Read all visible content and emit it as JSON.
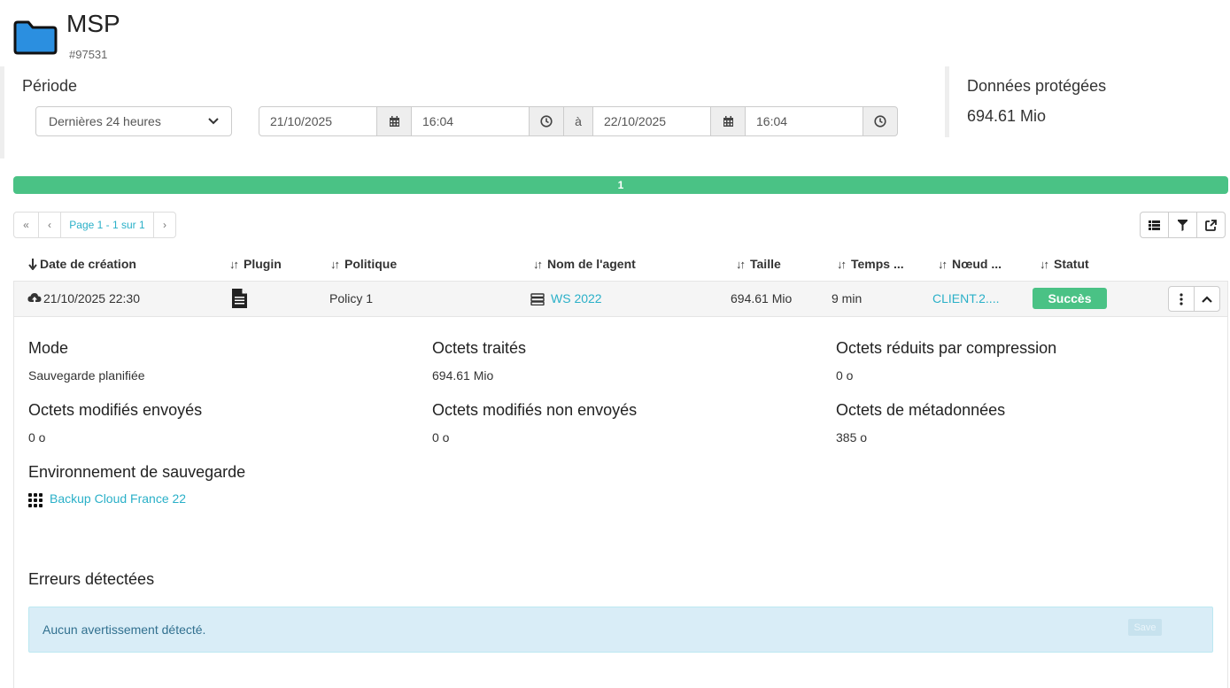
{
  "header": {
    "title": "MSP",
    "id": "#97531",
    "folder_color": "#2b8fe0"
  },
  "period": {
    "title": "Période",
    "range_selected": "Dernières 24 heures",
    "from_date": "21/10/2025",
    "from_time": "16:04",
    "separator": "à",
    "to_date": "22/10/2025",
    "to_time": "16:04"
  },
  "protected": {
    "title": "Données protégées",
    "value": "694.61 Mio"
  },
  "progress": {
    "label": "1",
    "fill_percent": 100,
    "color": "#4ac285"
  },
  "pagination": {
    "first": "«",
    "prev": "‹",
    "page_label": "Page 1 - 1 sur 1",
    "next": "›"
  },
  "toolbar": {
    "icons": [
      "list-view-icon",
      "filter-icon",
      "export-icon"
    ]
  },
  "table": {
    "columns": [
      "Date de création",
      "Plugin",
      "Politique",
      "Nom de l'agent",
      "Taille",
      "Temps ...",
      "Nœud ...",
      "Statut"
    ],
    "row": {
      "date": "21/10/2025 22:30",
      "policy": "Policy 1",
      "agent": "WS 2022",
      "size": "694.61 Mio",
      "duration": "9 min",
      "node": "CLIENT.2....",
      "status": "Succès",
      "status_color": "#4ac285"
    }
  },
  "details": {
    "mode_title": "Mode",
    "mode_value": "Sauvegarde planifiée",
    "processed_title": "Octets traités",
    "processed_value": "694.61 Mio",
    "compressed_title": "Octets réduits par compression",
    "compressed_value": "0 o",
    "modified_sent_title": "Octets modifiés envoyés",
    "modified_sent_value": "0 o",
    "modified_unsent_title": "Octets modifiés non envoyés",
    "modified_unsent_value": "0 o",
    "metadata_title": "Octets de métadonnées",
    "metadata_value": "385 o",
    "env_title": "Environnement de sauvegarde",
    "env_value": "Backup Cloud France 22"
  },
  "errors": {
    "title": "Erreurs détectées",
    "message": "Aucun avertissement détecté.",
    "save_label": "Save"
  }
}
